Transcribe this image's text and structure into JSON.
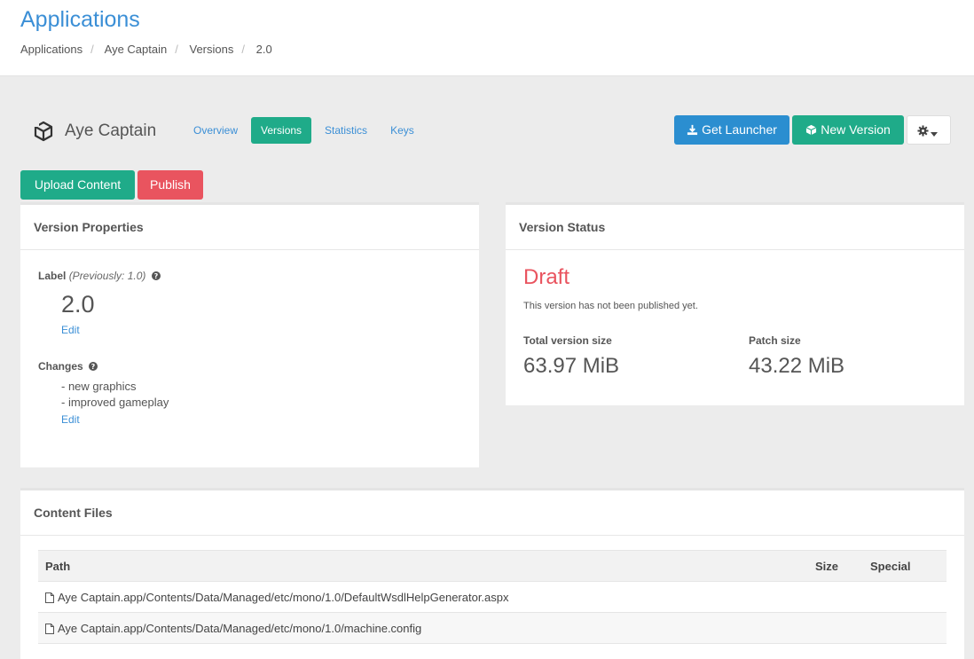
{
  "header": {
    "title": "Applications",
    "breadcrumb": [
      "Applications",
      "Aye Captain",
      "Versions",
      "2.0"
    ]
  },
  "app": {
    "name": "Aye Captain",
    "icon": "unity-icon"
  },
  "tabs": [
    {
      "label": "Overview",
      "active": false
    },
    {
      "label": "Versions",
      "active": true
    },
    {
      "label": "Statistics",
      "active": false
    },
    {
      "label": "Keys",
      "active": false
    }
  ],
  "actions": {
    "get_launcher": "Get Launcher",
    "new_version": "New Version",
    "upload_content": "Upload Content",
    "publish": "Publish"
  },
  "version_properties": {
    "heading": "Version Properties",
    "label_title": "Label",
    "label_previous": "(Previously: 1.0)",
    "label_value": "2.0",
    "edit": "Edit",
    "changes_title": "Changes",
    "changes": [
      "- new graphics",
      "- improved gameplay"
    ]
  },
  "version_status": {
    "heading": "Version Status",
    "status": "Draft",
    "status_note": "This version has not been published yet.",
    "total_label": "Total version size",
    "total_value": "63.97 MiB",
    "patch_label": "Patch size",
    "patch_value": "43.22 MiB"
  },
  "content_files": {
    "heading": "Content Files",
    "columns": [
      "Path",
      "Size",
      "Special"
    ],
    "rows": [
      {
        "path": "Aye Captain.app/Contents/Data/Managed/etc/mono/1.0/DefaultWsdlHelpGenerator.aspx",
        "size": "",
        "special": ""
      },
      {
        "path": "Aye Captain.app/Contents/Data/Managed/etc/mono/1.0/machine.config",
        "size": "",
        "special": ""
      }
    ]
  },
  "colors": {
    "primary": "#2b8ed0",
    "success": "#1fab89",
    "danger": "#e9545f",
    "title": "#3b8fd6"
  }
}
